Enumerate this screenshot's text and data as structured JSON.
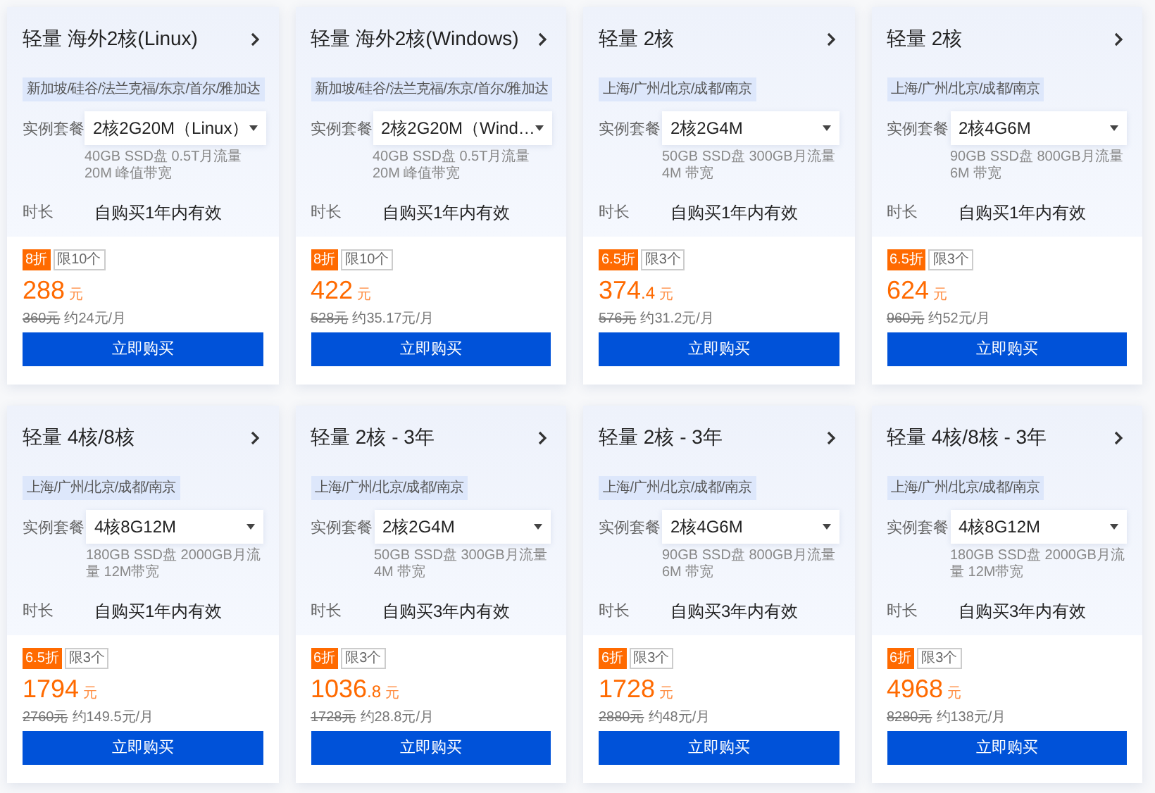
{
  "cards": [
    {
      "title": "轻量 海外2核(Linux)",
      "regions": "新加坡/硅谷/法兰克福/东京/首尔/雅加达",
      "plan_label": "实例套餐",
      "plan": "2核2G20M（Linux）",
      "spec": "40GB SSD盘 0.5T月流量 20M 峰值带宽",
      "duration_label": "时长",
      "duration": "自购买1年内有效",
      "discount": "8折",
      "limit": "限10个",
      "price": "288",
      "unit": "元",
      "original": "360元",
      "monthly": "约24元/月",
      "button": "立即购买"
    },
    {
      "title": "轻量 海外2核(Windows)",
      "regions": "新加坡/硅谷/法兰克福/东京/首尔/雅加达",
      "plan_label": "实例套餐",
      "plan": "2核2G20M（Wind…",
      "spec": "40GB SSD盘 0.5T月流量 20M 峰值带宽",
      "duration_label": "时长",
      "duration": "自购买1年内有效",
      "discount": "8折",
      "limit": "限10个",
      "price": "422",
      "unit": "元",
      "original": "528元",
      "monthly": "约35.17元/月",
      "button": "立即购买"
    },
    {
      "title": "轻量 2核",
      "regions": "上海/广州/北京/成都/南京",
      "plan_label": "实例套餐",
      "plan": "2核2G4M",
      "spec": "50GB SSD盘 300GB月流量 4M 带宽",
      "duration_label": "时长",
      "duration": "自购买1年内有效",
      "discount": "6.5折",
      "limit": "限3个",
      "price": "374",
      "price_decimal": ".4",
      "unit": "元",
      "original": "576元",
      "monthly": "约31.2元/月",
      "button": "立即购买"
    },
    {
      "title": "轻量 2核",
      "regions": "上海/广州/北京/成都/南京",
      "plan_label": "实例套餐",
      "plan": "2核4G6M",
      "spec": "90GB SSD盘 800GB月流量 6M 带宽",
      "duration_label": "时长",
      "duration": "自购买1年内有效",
      "discount": "6.5折",
      "limit": "限3个",
      "price": "624",
      "unit": "元",
      "original": "960元",
      "monthly": "约52元/月",
      "button": "立即购买"
    },
    {
      "title": "轻量 4核/8核",
      "regions": "上海/广州/北京/成都/南京",
      "plan_label": "实例套餐",
      "plan": "4核8G12M",
      "spec": "180GB SSD盘 2000GB月流量 12M带宽",
      "duration_label": "时长",
      "duration": "自购买1年内有效",
      "discount": "6.5折",
      "limit": "限3个",
      "price": "1794",
      "unit": "元",
      "original": "2760元",
      "monthly": "约149.5元/月",
      "button": "立即购买"
    },
    {
      "title": "轻量 2核 - 3年",
      "regions": "上海/广州/北京/成都/南京",
      "plan_label": "实例套餐",
      "plan": "2核2G4M",
      "spec": "50GB SSD盘 300GB月流量 4M 带宽",
      "duration_label": "时长",
      "duration": "自购买3年内有效",
      "discount": "6折",
      "limit": "限3个",
      "price": "1036",
      "price_decimal": ".8",
      "unit": "元",
      "original": "1728元",
      "monthly": "约28.8元/月",
      "button": "立即购买"
    },
    {
      "title": "轻量 2核 - 3年",
      "regions": "上海/广州/北京/成都/南京",
      "plan_label": "实例套餐",
      "plan": "2核4G6M",
      "spec": "90GB SSD盘 800GB月流量 6M 带宽",
      "duration_label": "时长",
      "duration": "自购买3年内有效",
      "discount": "6折",
      "limit": "限3个",
      "price": "1728",
      "unit": "元",
      "original": "2880元",
      "monthly": "约48元/月",
      "button": "立即购买"
    },
    {
      "title": "轻量 4核/8核 - 3年",
      "regions": "上海/广州/北京/成都/南京",
      "plan_label": "实例套餐",
      "plan": "4核8G12M",
      "spec": "180GB SSD盘 2000GB月流量 12M带宽",
      "duration_label": "时长",
      "duration": "自购买3年内有效",
      "discount": "6折",
      "limit": "限3个",
      "price": "4968",
      "unit": "元",
      "original": "8280元",
      "monthly": "约138元/月",
      "button": "立即购买"
    }
  ]
}
